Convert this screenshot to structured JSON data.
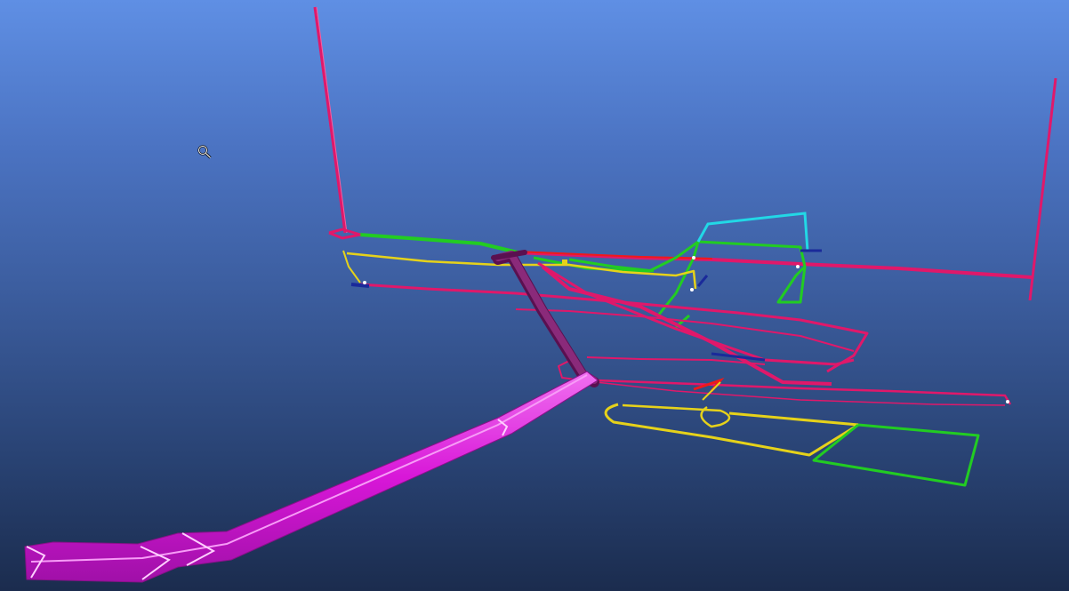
{
  "viewport": {
    "background_top": "#5f8fe4",
    "background_bottom": "#1b2c4e"
  },
  "legend_colors": {
    "main_drift": "#e0186a",
    "ramp_tube": "#d817d8",
    "decline_dark": "#7a1a6a",
    "level_green": "#22cc22",
    "level_yellow": "#e6d21a",
    "raise_cyan": "#22d8e6",
    "marker_blue": "#1a2a9a",
    "marker_red": "#ee1a1a"
  },
  "cursor": {
    "icon": "zoom-magnifier-icon"
  }
}
